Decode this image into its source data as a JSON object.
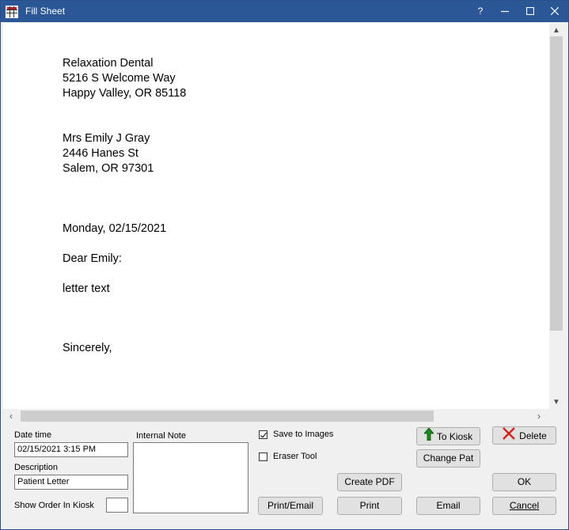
{
  "window": {
    "title": "Fill Sheet",
    "help": "?"
  },
  "sheet": {
    "lines": [
      "Relaxation Dental",
      "5216 S Welcome Way",
      "Happy Valley, OR  85118",
      "Mrs Emily J Gray",
      "2446 Hanes St",
      "Salem, OR 97301",
      "Monday, 02/15/2021",
      "Dear Emily:",
      "letter text",
      "Sincerely,"
    ]
  },
  "form": {
    "date_time_label": "Date time",
    "date_time_value": "02/15/2021 3:15 PM",
    "description_label": "Description",
    "description_value": "Patient Letter",
    "show_order_label": "Show Order In Kiosk",
    "show_order_value": "",
    "internal_note_label": "Internal Note",
    "internal_note_value": "",
    "save_to_images_label": "Save to Images",
    "save_to_images_checked": true,
    "eraser_tool_label": "Eraser Tool",
    "eraser_tool_checked": false
  },
  "buttons": {
    "to_kiosk": "To Kiosk",
    "delete": "Delete",
    "change_pat": "Change Pat",
    "create_pdf": "Create PDF",
    "ok": "OK",
    "print_email": "Print/Email",
    "print": "Print",
    "email": "Email",
    "cancel": "Cancel"
  },
  "colors": {
    "titlebar": "#2b5797",
    "kiosk_arrow": "#1a8a1a",
    "delete_x": "#d02020"
  }
}
